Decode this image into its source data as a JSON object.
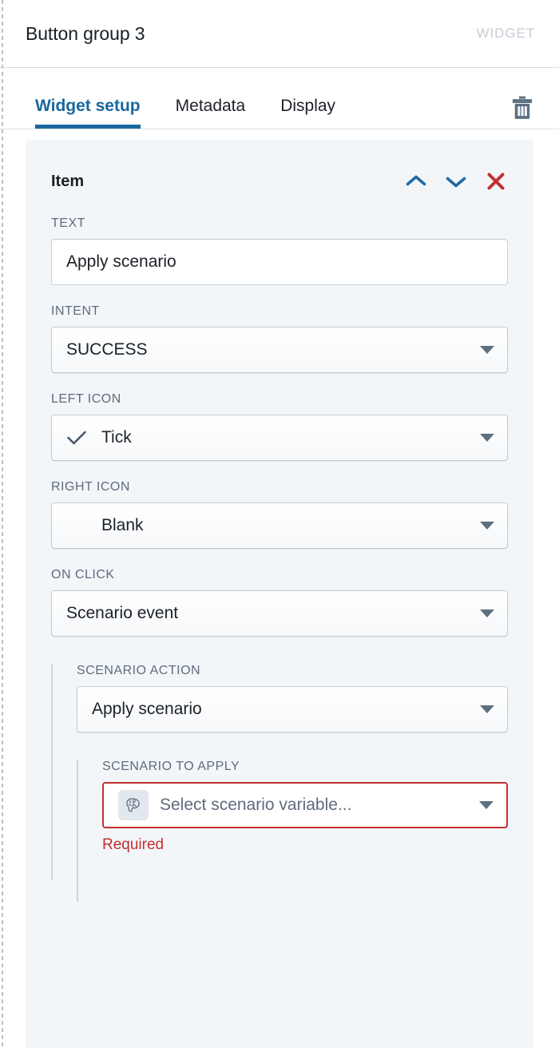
{
  "header": {
    "title": "Button group 3",
    "badge": "WIDGET"
  },
  "tabs": [
    {
      "label": "Widget setup",
      "active": true
    },
    {
      "label": "Metadata",
      "active": false
    },
    {
      "label": "Display",
      "active": false
    }
  ],
  "toolbar": {
    "delete_icon": "trash-icon"
  },
  "item": {
    "title": "Item",
    "actions": {
      "move_up": "chevron-up-icon",
      "move_down": "chevron-down-icon",
      "remove": "close-x-icon"
    }
  },
  "fields": {
    "text": {
      "label": "TEXT",
      "value": "Apply scenario"
    },
    "intent": {
      "label": "INTENT",
      "value": "SUCCESS"
    },
    "left_icon": {
      "label": "LEFT ICON",
      "value": "Tick",
      "icon": "tick-icon"
    },
    "right_icon": {
      "label": "RIGHT ICON",
      "value": "Blank",
      "icon": "blank-icon"
    },
    "on_click": {
      "label": "ON CLICK",
      "value": "Scenario event"
    },
    "scenario_action": {
      "label": "SCENARIO ACTION",
      "value": "Apply scenario"
    },
    "scenario_to_apply": {
      "label": "SCENARIO TO APPLY",
      "placeholder": "Select scenario variable...",
      "icon": "brain-icon",
      "error": "Required"
    }
  },
  "colors": {
    "accent_blue": "#19679E",
    "error_red": "#C23030",
    "panel_bg": "#F2F6F9",
    "label_gray": "#5F6B7C",
    "badge_gray": "#C5CCD4",
    "icon_slate": "#5C7080"
  }
}
